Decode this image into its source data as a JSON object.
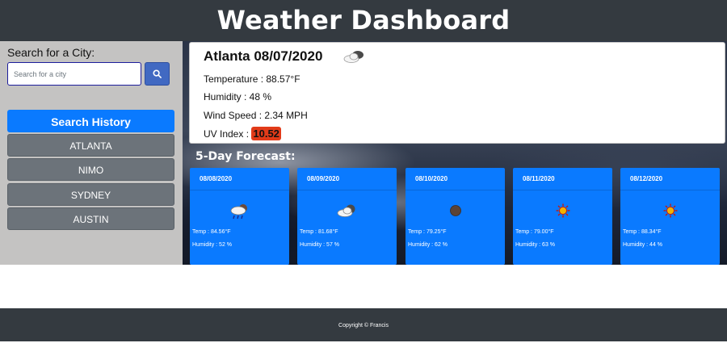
{
  "header": {
    "title": "Weather Dashboard"
  },
  "search": {
    "label": "Search for a City:",
    "placeholder": "Search for a city",
    "button_icon": "search-icon"
  },
  "history": {
    "title": "Search History",
    "items": [
      "ATLANTA",
      "NIMO",
      "SYDNEY",
      "AUSTIN"
    ]
  },
  "current": {
    "city_date": "Atlanta 08/07/2020",
    "icon": "partly-cloudy-icon",
    "temperature": "Temperature : 88.57°F",
    "humidity": "Humidity : 48 %",
    "wind": "Wind Speed : 2.34 MPH",
    "uv_label": "UV Index : ",
    "uv_value": "10.52",
    "uv_color": "#e23b19"
  },
  "forecast": {
    "title": "5-Day Forecast:",
    "days": [
      {
        "date": "08/08/2020",
        "icon": "rain-icon",
        "temp": "Temp : 84.56°F",
        "humidity": "Humidity : 52 %"
      },
      {
        "date": "08/09/2020",
        "icon": "partly-cloudy-icon",
        "temp": "Temp : 81.68°F",
        "humidity": "Humidity : 57 %"
      },
      {
        "date": "08/10/2020",
        "icon": "moon-icon",
        "temp": "Temp : 79.25°F",
        "humidity": "Humidity : 62 %"
      },
      {
        "date": "08/11/2020",
        "icon": "sun-icon",
        "temp": "Temp : 79.00°F",
        "humidity": "Humidity : 63 %"
      },
      {
        "date": "08/12/2020",
        "icon": "sun-icon",
        "temp": "Temp : 88.34°F",
        "humidity": "Humidity : 44 %"
      }
    ]
  },
  "footer": {
    "text": "Copyright © Francis"
  },
  "colors": {
    "header_bg": "#343a40",
    "accent": "#0a7aff",
    "history_item": "#6c737a",
    "sidebar_bg": "#c4c3c2"
  }
}
